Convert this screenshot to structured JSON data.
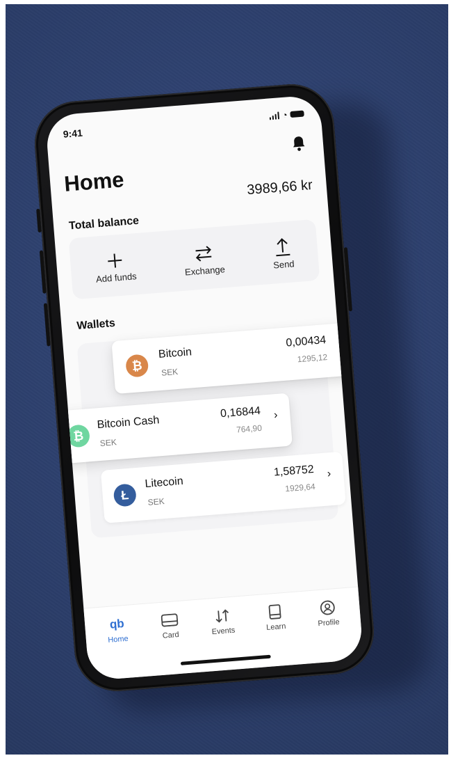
{
  "status": {
    "time": "9:41"
  },
  "header": {
    "title": "Home",
    "bell_icon": "bell-icon"
  },
  "balance": {
    "label": "Total balance",
    "value": "3989,66 kr"
  },
  "actions": [
    {
      "label": "Add funds",
      "icon": "plus-icon"
    },
    {
      "label": "Exchange",
      "icon": "exchange-arrows-icon"
    },
    {
      "label": "Send",
      "icon": "upload-arrow-icon"
    }
  ],
  "wallets": {
    "title": "Wallets",
    "items": [
      {
        "name": "Bitcoin",
        "currency": "SEK",
        "amount": "0,00434",
        "sek": "1295,12",
        "icon": "bitcoin-icon",
        "color": "#d9874a"
      },
      {
        "name": "Bitcoin Cash",
        "currency": "SEK",
        "amount": "0,16844",
        "sek": "764,90",
        "icon": "bitcoin-cash-icon",
        "color": "#6fd6a0"
      },
      {
        "name": "Litecoin",
        "currency": "SEK",
        "amount": "1,58752",
        "sek": "1929,64",
        "icon": "litecoin-icon",
        "color": "#345d9d"
      }
    ]
  },
  "tabs": [
    {
      "label": "Home",
      "icon": "qb-logo-icon",
      "active": true
    },
    {
      "label": "Card",
      "icon": "card-icon"
    },
    {
      "label": "Events",
      "icon": "events-arrows-icon"
    },
    {
      "label": "Learn",
      "icon": "book-icon"
    },
    {
      "label": "Profile",
      "icon": "profile-icon"
    }
  ],
  "colors": {
    "accent": "#2f6fd1",
    "background": "#2b3d69"
  }
}
